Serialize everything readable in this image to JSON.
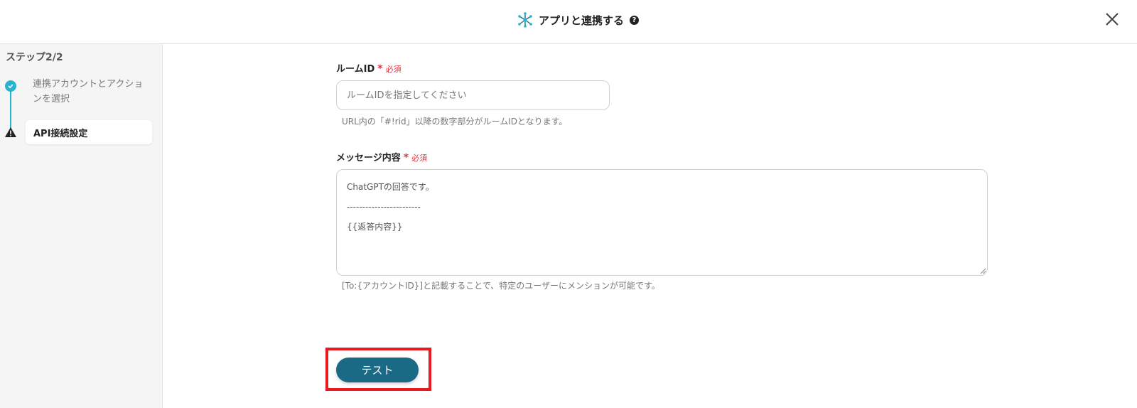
{
  "header": {
    "title": "アプリと連携する",
    "help_icon": "?",
    "icon": "network-hub-icon"
  },
  "sidebar": {
    "step_title": "ステップ2/2",
    "steps": [
      {
        "label": "連携アカウントとアクションを選択",
        "status": "done"
      },
      {
        "label": "API接続設定",
        "status": "warning"
      }
    ]
  },
  "form": {
    "room_id": {
      "label": "ルームID",
      "required_mark": "*",
      "required_text": "必須",
      "placeholder": "ルームIDを指定してください",
      "help": "URL内の「#!rid」以降の数字部分がルームIDとなります。"
    },
    "message": {
      "label": "メッセージ内容",
      "required_mark": "*",
      "required_text": "必須",
      "lines": [
        "ChatGPTの回答です。",
        "------------------------",
        "{{返答内容}}"
      ],
      "help": "[To:{アカウントID}]と記載することで、特定のユーザーにメンションが可能です。"
    },
    "test_button": "テスト"
  },
  "colors": {
    "accent": "#26b3cf",
    "button": "#1b6a85",
    "required": "#e0333e",
    "highlight": "#e8191f"
  }
}
